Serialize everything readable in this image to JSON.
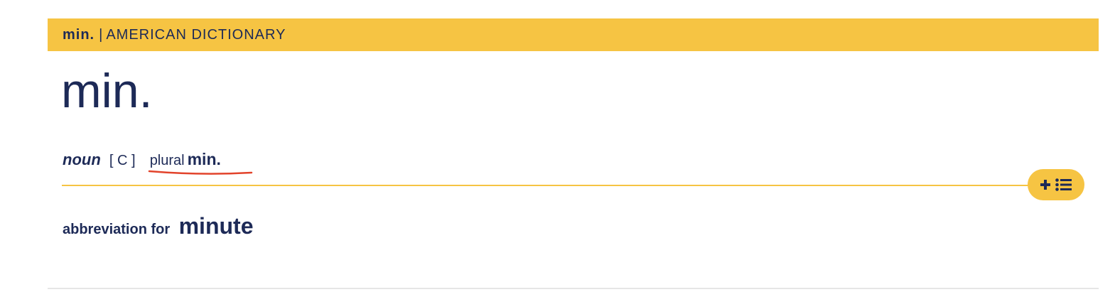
{
  "header": {
    "word": "min.",
    "separator": "|",
    "dictionary": "AMERICAN DICTIONARY"
  },
  "entry": {
    "headword": "min.",
    "part_of_speech": "noun",
    "grammar": "[ C ]",
    "plural_label": "plural",
    "plural_form": "min."
  },
  "definition": {
    "text": "abbreviation for",
    "xref": "minute"
  },
  "controls": {
    "add_to_list_icons": [
      "plus-icon",
      "list-icon"
    ]
  },
  "colors": {
    "header_bg": "#f6c443",
    "text": "#1d2a57",
    "underline": "#e2432b",
    "divider": "#f6c443"
  }
}
